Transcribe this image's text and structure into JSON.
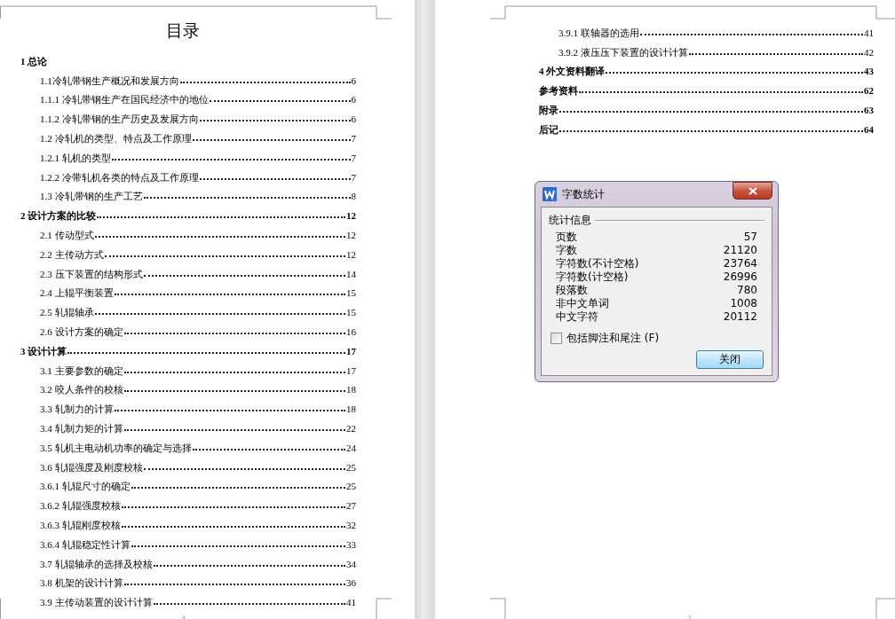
{
  "pages": [
    {
      "title": "目录",
      "page_number": "4",
      "entries": [
        {
          "kind": "chapter",
          "text": "1  总论"
        },
        {
          "kind": "section",
          "text": "1.1冷轧带钢生产概况和发展方向",
          "page": "6"
        },
        {
          "kind": "section",
          "text": "1.1.1  冷轧带钢生产在国民经济中的地位",
          "page": "6"
        },
        {
          "kind": "section",
          "text": "1.1.2 冷轧带钢的生产历史及发展方向",
          "page": "6"
        },
        {
          "kind": "section",
          "text": "1.2  冷轧机的类型、特点及工作原理",
          "page": "7"
        },
        {
          "kind": "section",
          "text": "1.2.1  轧机的类型",
          "page": "7"
        },
        {
          "kind": "section",
          "text": "1.2.2  冷带轧机各类的特点及工作原理",
          "page": "7"
        },
        {
          "kind": "section",
          "text": "1.3  冷轧带钢的生产工艺",
          "page": "8"
        },
        {
          "kind": "chapter",
          "text": "2  设计方案的比较",
          "page": "12"
        },
        {
          "kind": "section",
          "text": "2.1  传动型式",
          "page": "12"
        },
        {
          "kind": "section",
          "text": "2.2  主传动方式",
          "page": "12"
        },
        {
          "kind": "section",
          "text": "2.3  压下装置的结构形式",
          "page": "14"
        },
        {
          "kind": "section",
          "text": "2.4  上辊平衡装置",
          "page": "15"
        },
        {
          "kind": "section",
          "text": "2.5  轧辊轴承",
          "page": "15"
        },
        {
          "kind": "section",
          "text": "2.6  设计方案的确定",
          "page": "16"
        },
        {
          "kind": "chapter",
          "text": "3  设计计算",
          "page": "17"
        },
        {
          "kind": "section",
          "text": "3.1  主要参数的确定",
          "page": "17"
        },
        {
          "kind": "section",
          "text": "3.2  咬人条件的校核",
          "page": "18"
        },
        {
          "kind": "section",
          "text": "3.3  轧制力的计算",
          "page": "18"
        },
        {
          "kind": "section",
          "text": "3.4  轧制力矩的计算",
          "page": "22"
        },
        {
          "kind": "section",
          "text": "3.5  轧机主电动机功率的确定与选择",
          "page": "24"
        },
        {
          "kind": "section",
          "text": "3.6  轧辊强度及刚度校核",
          "page": "25"
        },
        {
          "kind": "section",
          "text": "3.6.1  轧辊尺寸的确定",
          "page": "25"
        },
        {
          "kind": "section",
          "text": "3.6.2  轧辊强度校核",
          "page": "27"
        },
        {
          "kind": "section",
          "text": "3.6.3  轧辊刚度校核",
          "page": "32"
        },
        {
          "kind": "section",
          "text": "3.6.4  轧辊稳定性计算",
          "page": "33"
        },
        {
          "kind": "section",
          "text": "3.7  轧辊轴承的选择及校核",
          "page": "34"
        },
        {
          "kind": "section",
          "text": "3.8  机架的设计计算",
          "page": "36"
        },
        {
          "kind": "section",
          "text": "3.9  主传动装置的设计计算",
          "page": "41"
        }
      ]
    },
    {
      "page_number": "5",
      "entries": [
        {
          "kind": "section",
          "text": "3.9.1  联轴器的选用",
          "page": "41"
        },
        {
          "kind": "section",
          "text": "3.9.2  液压压下装置的设计计算",
          "page": "42"
        },
        {
          "kind": "chapter",
          "text": "4  外文资料翻译",
          "page": "43"
        },
        {
          "kind": "chapter",
          "text": "参考资料",
          "page": "62"
        },
        {
          "kind": "chapter",
          "text": "附录",
          "page": "63"
        },
        {
          "kind": "chapter",
          "text": "后记",
          "page": "64"
        }
      ]
    }
  ],
  "dialog": {
    "title": "字数统计",
    "group": "统计信息",
    "stats": [
      {
        "label": "页数",
        "value": "57"
      },
      {
        "label": "字数",
        "value": "21120"
      },
      {
        "label": "字符数(不计空格)",
        "value": "23764"
      },
      {
        "label": "字符数(计空格)",
        "value": "26996"
      },
      {
        "label": "段落数",
        "value": "780"
      },
      {
        "label": "非中文单词",
        "value": "1008"
      },
      {
        "label": "中文字符",
        "value": "20112"
      }
    ],
    "checkbox": {
      "label": "包括脚注和尾注",
      "accelerator": "(F)",
      "checked": false
    },
    "button": "关闭"
  }
}
